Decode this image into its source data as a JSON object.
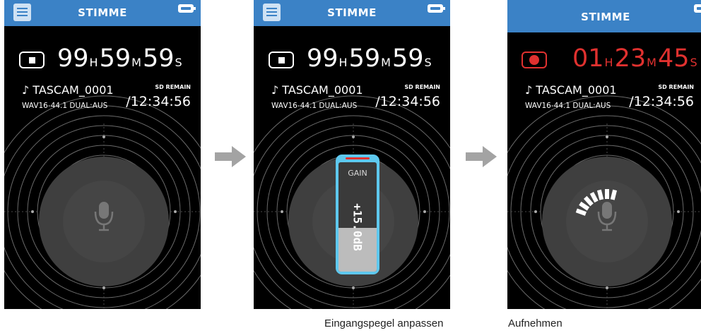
{
  "screens": [
    {
      "header_title": "STIMME",
      "transport": "stop",
      "time": {
        "hours": "99",
        "h_unit": "H",
        "minutes": "59",
        "m_unit": "M",
        "seconds": "59",
        "s_unit": "S"
      },
      "file_name": "♪ TASCAM_0001",
      "format": "WAV16-44.1 DUAL:AUS",
      "sd_label": "SD REMAIN",
      "sd_remain": "/12:34:56",
      "level_segments": 0,
      "caption": ""
    },
    {
      "header_title": "STIMME",
      "transport": "stop",
      "time": {
        "hours": "99",
        "h_unit": "H",
        "minutes": "59",
        "m_unit": "M",
        "seconds": "59",
        "s_unit": "S"
      },
      "file_name": "♪ TASCAM_0001",
      "format": "WAV16-44.1 DUAL:AUS",
      "sd_label": "SD REMAIN",
      "sd_remain": "/12:34:56",
      "gain_popup": {
        "label": "GAIN",
        "value": "+15.0dB",
        "level_fraction": 0.4
      },
      "caption": "Eingangspegel anpassen"
    },
    {
      "header_title": "STIMME",
      "transport": "record",
      "time": {
        "hours": "01",
        "h_unit": "H",
        "minutes": "23",
        "m_unit": "M",
        "seconds": "45",
        "s_unit": "S"
      },
      "file_name": "♪ TASCAM_0001",
      "format": "WAV16-44.1 DUAL:AUS",
      "sd_label": "SD REMAIN",
      "sd_remain": "/12:34:56",
      "level_segments": 7,
      "caption": "Aufnehmen"
    }
  ],
  "icons": {
    "menu": "hamburger-menu-icon",
    "battery": "battery-icon",
    "mic": "microphone-icon",
    "stop": "stop-icon",
    "record": "record-icon",
    "arrow": "right-arrow-icon"
  },
  "colors": {
    "header": "#3b82c6",
    "record_red": "#e0312f",
    "gain_frame": "#5ec8ee",
    "dial": "#3f3f3f",
    "background": "#000000"
  }
}
